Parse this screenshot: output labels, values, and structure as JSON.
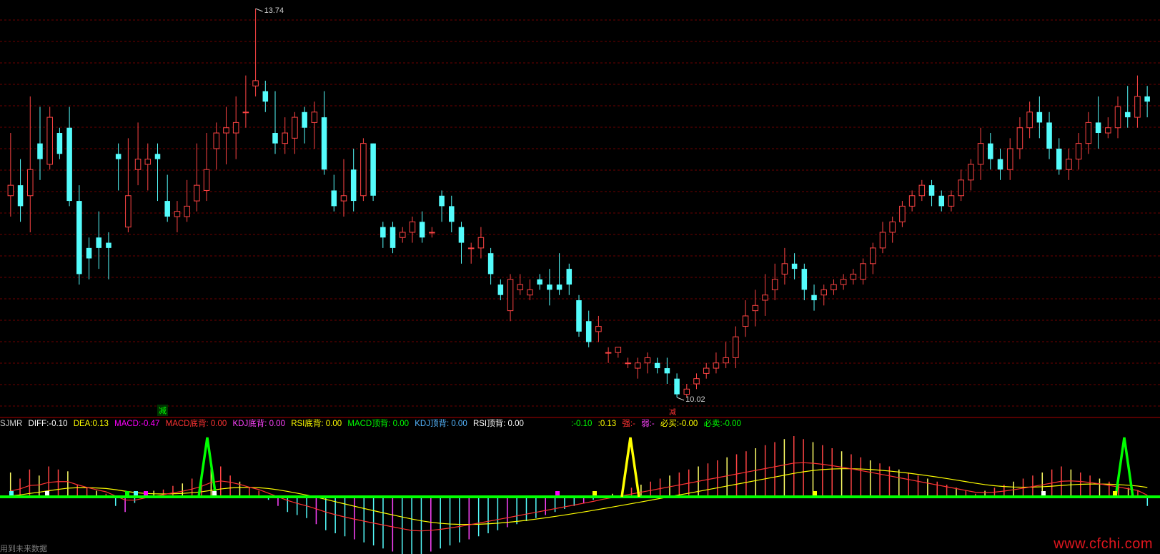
{
  "chart_data": {
    "type": "candlestick",
    "price_high_label": "13.74",
    "price_low_label": "10.02",
    "signal_tag": "减",
    "signal_tag_low": "减",
    "colors": {
      "up": "#ff4444",
      "down": "#54fcfc",
      "grid": "#6e0000",
      "diff": "#ffffff",
      "dea": "#ffff00",
      "zero_line": "#00ff00"
    },
    "candles": [
      [
        11.95,
        12.05,
        11.75,
        12.55
      ],
      [
        12.05,
        11.85,
        11.7,
        12.3
      ],
      [
        11.95,
        12.2,
        11.6,
        12.9
      ],
      [
        12.45,
        12.3,
        12.1,
        12.8
      ],
      [
        12.25,
        12.7,
        12.2,
        12.8
      ],
      [
        12.55,
        12.35,
        12.3,
        12.6
      ],
      [
        12.6,
        11.9,
        11.85,
        12.8
      ],
      [
        11.9,
        11.2,
        11.1,
        12.05
      ],
      [
        11.45,
        11.35,
        11.15,
        11.55
      ],
      [
        11.55,
        11.45,
        11.25,
        11.8
      ],
      [
        11.5,
        11.45,
        11.15,
        11.6
      ],
      [
        12.35,
        12.3,
        12.0,
        12.45
      ],
      [
        11.65,
        11.95,
        11.6,
        12.5
      ],
      [
        12.2,
        12.3,
        12.05,
        12.65
      ],
      [
        12.25,
        12.3,
        12.0,
        12.45
      ],
      [
        12.35,
        12.3,
        11.9,
        12.45
      ],
      [
        11.9,
        11.75,
        11.7,
        12.15
      ],
      [
        11.75,
        11.8,
        11.6,
        11.9
      ],
      [
        11.75,
        11.85,
        11.7,
        12.1
      ],
      [
        11.9,
        12.05,
        11.8,
        12.45
      ],
      [
        12.0,
        12.2,
        11.9,
        12.55
      ],
      [
        12.4,
        12.55,
        12.2,
        12.65
      ],
      [
        12.55,
        12.6,
        12.25,
        12.8
      ],
      [
        12.55,
        12.65,
        12.3,
        12.9
      ],
      [
        12.75,
        12.75,
        12.6,
        13.1
      ],
      [
        13.0,
        13.05,
        12.9,
        13.74
      ],
      [
        12.95,
        12.85,
        12.75,
        13.05
      ],
      [
        12.55,
        12.45,
        12.35,
        12.95
      ],
      [
        12.45,
        12.55,
        12.35,
        12.7
      ],
      [
        12.5,
        12.7,
        12.35,
        12.75
      ],
      [
        12.75,
        12.6,
        12.45,
        12.8
      ],
      [
        12.65,
        12.75,
        12.4,
        12.85
      ],
      [
        12.7,
        12.2,
        12.15,
        12.95
      ],
      [
        12.0,
        11.85,
        11.8,
        12.15
      ],
      [
        11.9,
        11.95,
        11.75,
        12.3
      ],
      [
        12.2,
        11.9,
        11.8,
        12.4
      ],
      [
        11.95,
        12.45,
        11.9,
        12.5
      ],
      [
        12.45,
        11.95,
        11.9,
        12.45
      ],
      [
        11.65,
        11.55,
        11.45,
        11.7
      ],
      [
        11.65,
        11.45,
        11.4,
        11.7
      ],
      [
        11.55,
        11.6,
        11.5,
        11.65
      ],
      [
        11.6,
        11.7,
        11.5,
        11.75
      ],
      [
        11.7,
        11.55,
        11.5,
        11.8
      ],
      [
        11.6,
        11.6,
        11.55,
        11.65
      ],
      [
        11.95,
        11.85,
        11.7,
        12.0
      ],
      [
        11.85,
        11.7,
        11.6,
        11.95
      ],
      [
        11.65,
        11.5,
        11.3,
        11.7
      ],
      [
        11.45,
        11.45,
        11.3,
        11.5
      ],
      [
        11.45,
        11.55,
        11.35,
        11.65
      ],
      [
        11.4,
        11.2,
        11.1,
        11.45
      ],
      [
        11.1,
        11.0,
        10.95,
        11.15
      ],
      [
        10.85,
        11.15,
        10.75,
        11.2
      ],
      [
        11.05,
        11.1,
        11.0,
        11.2
      ],
      [
        11.0,
        11.05,
        10.95,
        11.15
      ],
      [
        11.15,
        11.1,
        11.05,
        11.2
      ],
      [
        11.1,
        11.05,
        10.9,
        11.25
      ],
      [
        11.1,
        11.05,
        11.0,
        11.4
      ],
      [
        11.25,
        11.1,
        11.0,
        11.3
      ],
      [
        10.95,
        10.65,
        10.6,
        11.0
      ],
      [
        10.75,
        10.55,
        10.5,
        10.85
      ],
      [
        10.65,
        10.7,
        10.55,
        10.8
      ],
      [
        10.45,
        10.45,
        10.35,
        10.5
      ],
      [
        10.45,
        10.5,
        10.4,
        10.5
      ],
      [
        10.35,
        10.35,
        10.3,
        10.4
      ],
      [
        10.3,
        10.35,
        10.2,
        10.4
      ],
      [
        10.35,
        10.4,
        10.25,
        10.45
      ],
      [
        10.35,
        10.3,
        10.25,
        10.4
      ],
      [
        10.3,
        10.25,
        10.15,
        10.4
      ],
      [
        10.2,
        10.05,
        10.02,
        10.25
      ],
      [
        10.05,
        10.1,
        10.02,
        10.15
      ],
      [
        10.15,
        10.2,
        10.1,
        10.25
      ],
      [
        10.25,
        10.3,
        10.2,
        10.35
      ],
      [
        10.3,
        10.35,
        10.25,
        10.45
      ],
      [
        10.35,
        10.4,
        10.3,
        10.55
      ],
      [
        10.4,
        10.6,
        10.3,
        10.7
      ],
      [
        10.7,
        10.8,
        10.6,
        10.95
      ],
      [
        10.85,
        10.9,
        10.7,
        11.05
      ],
      [
        10.95,
        11.0,
        10.8,
        11.2
      ],
      [
        11.05,
        11.15,
        10.95,
        11.3
      ],
      [
        11.2,
        11.3,
        11.1,
        11.45
      ],
      [
        11.3,
        11.25,
        11.15,
        11.4
      ],
      [
        11.25,
        11.05,
        10.95,
        11.3
      ],
      [
        11.0,
        10.95,
        10.85,
        11.1
      ],
      [
        11.0,
        11.05,
        10.9,
        11.1
      ],
      [
        11.05,
        11.1,
        11.0,
        11.15
      ],
      [
        11.1,
        11.15,
        11.05,
        11.2
      ],
      [
        11.15,
        11.2,
        11.1,
        11.25
      ],
      [
        11.15,
        11.3,
        11.1,
        11.35
      ],
      [
        11.3,
        11.45,
        11.2,
        11.5
      ],
      [
        11.45,
        11.6,
        11.4,
        11.7
      ],
      [
        11.6,
        11.7,
        11.5,
        11.75
      ],
      [
        11.7,
        11.85,
        11.65,
        11.9
      ],
      [
        11.85,
        11.95,
        11.8,
        12.0
      ],
      [
        11.95,
        12.05,
        11.9,
        12.1
      ],
      [
        12.05,
        11.95,
        11.85,
        12.1
      ],
      [
        11.95,
        11.85,
        11.8,
        12.0
      ],
      [
        11.85,
        11.95,
        11.8,
        12.0
      ],
      [
        11.95,
        12.1,
        11.9,
        12.2
      ],
      [
        12.1,
        12.25,
        12.0,
        12.3
      ],
      [
        12.25,
        12.45,
        12.1,
        12.6
      ],
      [
        12.45,
        12.3,
        12.2,
        12.55
      ],
      [
        12.3,
        12.2,
        12.1,
        12.4
      ],
      [
        12.2,
        12.4,
        12.1,
        12.5
      ],
      [
        12.4,
        12.6,
        12.3,
        12.7
      ],
      [
        12.6,
        12.75,
        12.5,
        12.85
      ],
      [
        12.75,
        12.65,
        12.5,
        12.9
      ],
      [
        12.65,
        12.4,
        12.3,
        12.75
      ],
      [
        12.4,
        12.2,
        12.15,
        12.5
      ],
      [
        12.2,
        12.3,
        12.1,
        12.4
      ],
      [
        12.3,
        12.45,
        12.2,
        12.55
      ],
      [
        12.45,
        12.65,
        12.35,
        12.75
      ],
      [
        12.65,
        12.55,
        12.4,
        12.9
      ],
      [
        12.55,
        12.6,
        12.5,
        12.7
      ],
      [
        12.6,
        12.8,
        12.5,
        12.9
      ],
      [
        12.75,
        12.7,
        12.6,
        13.0
      ],
      [
        12.7,
        12.9,
        12.6,
        13.1
      ],
      [
        12.9,
        12.85,
        12.7,
        13.0
      ]
    ],
    "macd_bars": [
      0.4,
      0.3,
      0.45,
      0.35,
      0.5,
      0.45,
      0.42,
      0.2,
      0.15,
      0.1,
      0.05,
      -0.15,
      -0.25,
      -0.1,
      0.05,
      0.1,
      0.12,
      0.18,
      0.22,
      0.3,
      0.4,
      0.55,
      0.5,
      0.35,
      0.25,
      0.15,
      0.1,
      -0.05,
      -0.15,
      -0.25,
      -0.3,
      -0.35,
      -0.45,
      -0.55,
      -0.6,
      -0.65,
      -0.7,
      -0.75,
      -0.8,
      -0.85,
      -0.9,
      -0.95,
      -1.0,
      -0.95,
      -0.9,
      -0.85,
      -0.8,
      -0.75,
      -0.7,
      -0.65,
      -0.6,
      -0.55,
      -0.5,
      -0.45,
      -0.4,
      -0.35,
      -0.3,
      -0.25,
      -0.2,
      -0.15,
      -0.1,
      -0.05,
      0.02,
      0.05,
      0.1,
      0.15,
      0.2,
      0.25,
      0.3,
      0.35,
      0.4,
      0.45,
      0.5,
      0.55,
      0.6,
      0.65,
      0.7,
      0.75,
      0.8,
      0.85,
      0.9,
      0.95,
      1.0,
      0.95,
      0.9,
      0.85,
      0.8,
      0.75,
      0.7,
      0.65,
      0.6,
      0.55,
      0.5,
      0.45,
      0.4,
      0.35,
      0.3,
      0.25,
      0.2,
      0.15,
      0.1,
      0.05,
      0.1,
      0.15,
      0.2,
      0.25,
      0.3,
      0.35,
      0.4,
      0.45,
      0.5,
      0.45,
      0.4,
      0.35,
      0.3,
      0.25,
      0.2,
      0.15,
      0.1,
      -0.15
    ]
  },
  "indicator_bar": {
    "name": "SJMR",
    "diff_label": "DIFF:",
    "diff_value": "-0.10",
    "dea_label": "DEA:",
    "dea_value": "0.13",
    "macd_label": "MACD:",
    "macd_value": "-0.47",
    "macd_bottom_label": "MACD底背:",
    "macd_bottom_value": "0.00",
    "kdj_bottom_label": "KDJ底背:",
    "kdj_bottom_value": "0.00",
    "rsi_bottom_label": "RSI底背:",
    "rsi_bottom_value": "0.00",
    "macd_top_label": "MACD顶背:",
    "macd_top_value": "0.00",
    "kdj_top_label": "KDJ顶背:",
    "kdj_top_value": "0.00",
    "rsi_top_label": "RSI顶背:",
    "rsi_top_value": "0.00"
  },
  "right_readout": {
    "a": ":-0.10",
    "b": ":0.13",
    "strong": "强:-",
    "weak": "弱:-",
    "must_buy": "必买:-0.00",
    "must_sell": "必卖:-0.00"
  },
  "watermark": "www.cfchi.com",
  "footer_text": "用到未来数据"
}
